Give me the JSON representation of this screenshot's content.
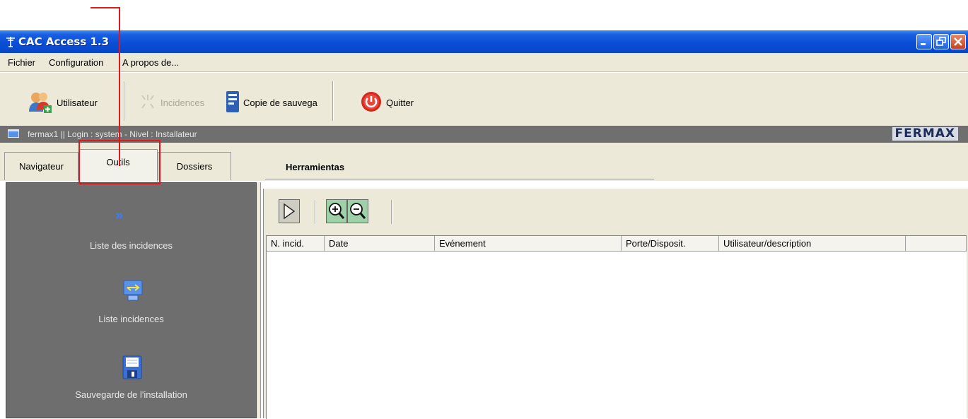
{
  "window": {
    "title": "CAC Access 1.3",
    "icon": "antenna-icon"
  },
  "menu": [
    "Fichier",
    "Configuration",
    "A propos de..."
  ],
  "toolbar": {
    "user_label": "Utilisateur",
    "incidents_label": "Incidences",
    "backup_label": "Copie de sauvega",
    "quit_label": "Quitter"
  },
  "status": {
    "text": "fermax1 || Login : system - Nivel : Installateur",
    "brand": "FERMAX"
  },
  "tabs": [
    {
      "label": "Navigateur",
      "active": false
    },
    {
      "label": "Outils",
      "active": true
    },
    {
      "label": "Dossiers",
      "active": false
    }
  ],
  "panel_title": "Herramientas",
  "left_panel": {
    "items": [
      {
        "label": "Liste des incidences",
        "icon": "chevron-double-right-icon"
      },
      {
        "label": "Liste incidences",
        "icon": "incidents-list-icon"
      },
      {
        "label": "Sauvegarde de l'installation",
        "icon": "floppy-disk-icon"
      }
    ]
  },
  "grid": {
    "columns": [
      "N. incid.",
      "Date",
      "Evénement",
      "Porte/Disposit.",
      "Utilisateur/description",
      ""
    ]
  },
  "colors": {
    "annotation": "#e0191c",
    "titlebar": "#0a4fd8",
    "panel": "#6e6e6e"
  }
}
